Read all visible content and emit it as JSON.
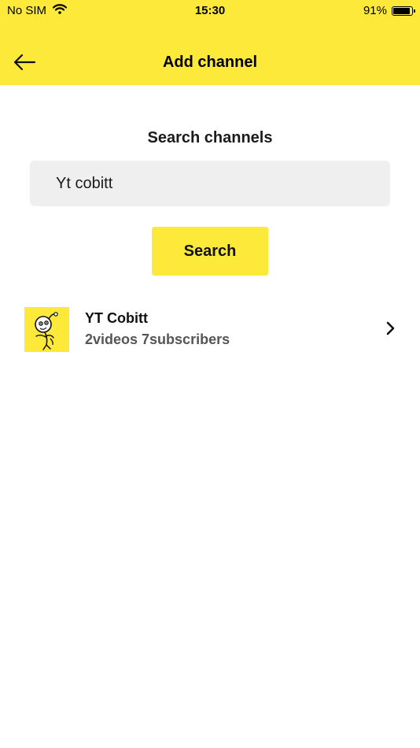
{
  "status_bar": {
    "carrier": "No SIM",
    "time": "15:30",
    "battery_percent": "91%",
    "battery_level": 0.91
  },
  "header": {
    "title": "Add channel",
    "back_icon": "arrow-left-icon"
  },
  "search": {
    "title": "Search channels",
    "value": "Yt cobitt",
    "button_label": "Search"
  },
  "results": [
    {
      "name": "YT Cobitt",
      "meta": "2videos 7subscribers",
      "avatar_icon": "cartoon-character-avatar",
      "chevron_icon": "chevron-right-icon"
    }
  ],
  "colors": {
    "accent": "#FDE93A",
    "input_bg": "#EFEFEF",
    "meta_text": "#555555"
  }
}
